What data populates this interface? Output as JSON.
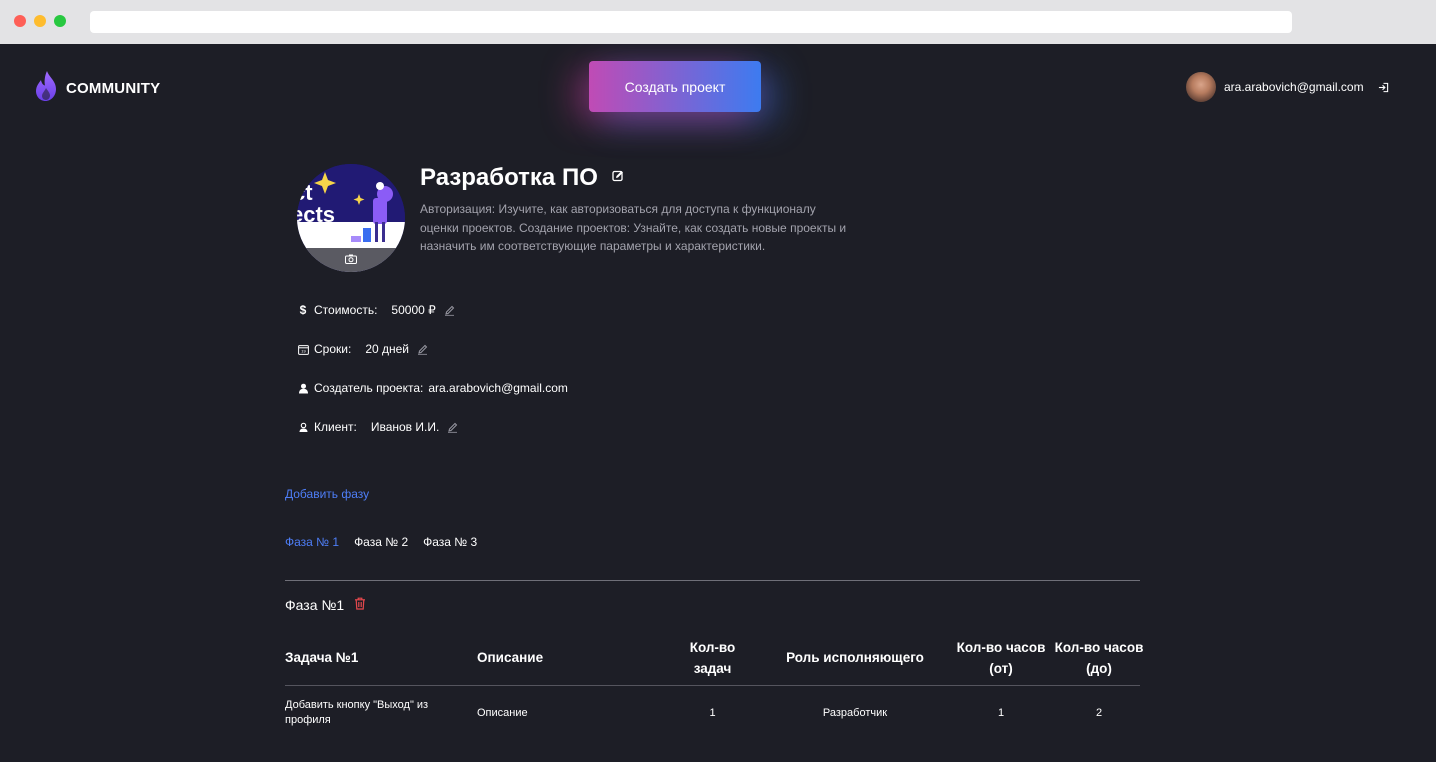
{
  "header": {
    "logo_text": "COMMUNITY",
    "create_button": "Создать проект",
    "user_email": "ara.arabovich@gmail.com"
  },
  "project": {
    "title": "Разработка ПО",
    "description": "Авторизация: Изучите, как авторизоваться для доступа к функционалу оценки проектов. Создание проектов: Узнайте, как создать новые проекты и назначить им соответствующие параметры и характеристики.",
    "cover_text": "ct\nects",
    "fields": {
      "cost_label": "Стоимость:",
      "cost_value": "50000 ₽",
      "deadline_label": "Сроки:",
      "deadline_value": "20 дней",
      "creator_label": "Создатель проекта:",
      "creator_value": "ara.arabovich@gmail.com",
      "client_label": "Клиент:",
      "client_value": "Иванов И.И."
    }
  },
  "phases": {
    "add_label": "Добавить фазу",
    "tabs": [
      "Фаза № 1",
      "Фаза № 2",
      "Фаза № 3"
    ],
    "active_tab": 0,
    "current_title": "Фаза №1"
  },
  "table": {
    "headers": [
      "Задача №1",
      "Описание",
      "Кол-во задач",
      "Роль исполняющего",
      "Кол-во часов (от)",
      "Кол-во часов (до)"
    ],
    "rows": [
      [
        "Добавить кнопку \"Выход\" из профиля",
        "Описание",
        "1",
        "Разработчик",
        "1",
        "2"
      ]
    ]
  },
  "colors": {
    "background": "#1d1e26",
    "accent": "#4e7ef7",
    "gradient_start": "#c04bb5",
    "gradient_end": "#3d7bf0",
    "danger": "#e5484d"
  },
  "icons": [
    "flame-icon",
    "avatar",
    "logout-icon",
    "camera-icon",
    "edit-icon",
    "dollar-icon",
    "calendar-icon",
    "creator-icon",
    "client-icon",
    "trash-icon"
  ]
}
